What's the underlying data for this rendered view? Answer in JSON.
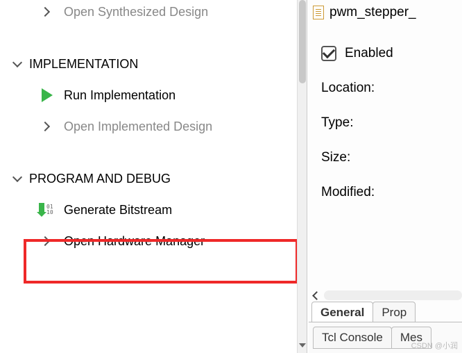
{
  "flow": {
    "open_synth": "Open Synthesized Design",
    "impl_header": "IMPLEMENTATION",
    "run_impl": "Run Implementation",
    "open_impl": "Open Implemented Design",
    "prog_debug_header": "PROGRAM AND DEBUG",
    "gen_bitstream": "Generate Bitstream",
    "open_hw_mgr": "Open Hardware Manager"
  },
  "props": {
    "file_name": "pwm_stepper_",
    "enabled_label": "Enabled",
    "enabled_checked": true,
    "location_label": "Location:",
    "type_label": "Type:",
    "size_label": "Size:",
    "modified_label": "Modified:",
    "tab_general": "General",
    "tab_properties": "Prop"
  },
  "bottom": {
    "tcl_console": "Tcl Console",
    "messages": "Mes"
  },
  "watermark": "CSDN @小润"
}
